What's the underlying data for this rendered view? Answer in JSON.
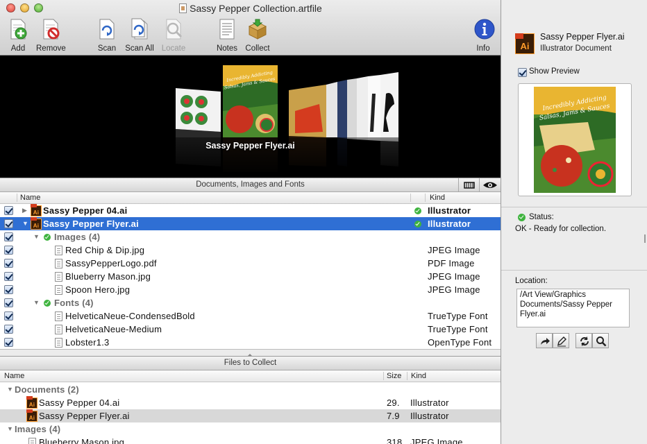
{
  "window": {
    "title": "Sassy Pepper Collection.artfile"
  },
  "toolbar": {
    "add": "Add",
    "remove": "Remove",
    "scan": "Scan",
    "scan_all": "Scan All",
    "locate": "Locate",
    "notes": "Notes",
    "collect": "Collect",
    "info": "Info"
  },
  "preview": {
    "caption": "Sassy Pepper Flyer.ai",
    "flyer_text": "Incredibly Addicting Salsas, Jams & Sauces"
  },
  "docs_panel": {
    "title": "Documents, Images and Fonts",
    "col_name": "Name",
    "col_kind": "Kind",
    "rows": [
      {
        "name": "Sassy Pepper 04.ai",
        "kind": "Illustrator"
      },
      {
        "name": "Sassy Pepper Flyer.ai",
        "kind": "Illustrator"
      },
      {
        "name": "Images (4)",
        "kind": ""
      },
      {
        "name": "Red Chip & Dip.jpg",
        "kind": "JPEG Image"
      },
      {
        "name": "SassyPepperLogo.pdf",
        "kind": "PDF Image"
      },
      {
        "name": "Blueberry Mason.jpg",
        "kind": "JPEG Image"
      },
      {
        "name": "Spoon Hero.jpg",
        "kind": "JPEG Image"
      },
      {
        "name": "Fonts (4)",
        "kind": ""
      },
      {
        "name": "HelveticaNeue-CondensedBold",
        "kind": "TrueType Font"
      },
      {
        "name": "HelveticaNeue-Medium",
        "kind": "TrueType Font"
      },
      {
        "name": "Lobster1.3",
        "kind": "OpenType Font"
      }
    ]
  },
  "collect_panel": {
    "title": "Files to Collect",
    "col_name": "Name",
    "col_size": "Size",
    "col_kind": "Kind",
    "rows": [
      {
        "name": "Documents (2)",
        "size": "",
        "kind": ""
      },
      {
        "name": "Sassy Pepper 04.ai",
        "size": "29.",
        "kind": "Illustrator"
      },
      {
        "name": "Sassy Pepper Flyer.ai",
        "size": "7.9",
        "kind": "Illustrator"
      },
      {
        "name": "Images (4)",
        "size": "",
        "kind": ""
      },
      {
        "name": "Blueberry Mason.jpg",
        "size": "318",
        "kind": "JPEG Image"
      }
    ]
  },
  "inspector": {
    "file_name": "Sassy Pepper Flyer.ai",
    "file_kind": "Illustrator Document",
    "icon_label": "Ai",
    "show_preview": "Show Preview",
    "status_label": "Status:",
    "status_text": "OK - Ready for collection.",
    "location_label": "Location:",
    "location_value": "/Art View/Graphics Documents/Sassy Pepper Flyer.ai",
    "thumb_text": "Incredibly Addicting Salsas, Jams & Sauces"
  },
  "colors": {
    "selection": "#2f6fd4",
    "ok_green": "#3fb43f",
    "ai_orange": "#ff9c2a"
  }
}
